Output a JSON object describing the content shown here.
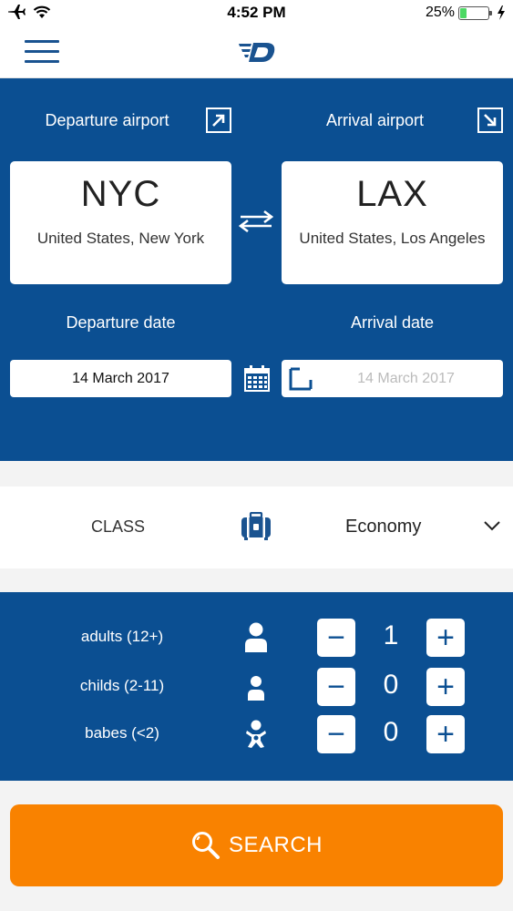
{
  "status_bar": {
    "time": "4:52 PM",
    "battery_percent": "25%",
    "battery_level": 0.25,
    "icons": [
      "airplane-mode-icon",
      "wifi-icon",
      "battery-icon",
      "charging-icon"
    ]
  },
  "nav": {
    "menu_icon": "hamburger-icon",
    "logo_icon": "winged-d-logo"
  },
  "flight": {
    "departure_label": "Departure airport",
    "arrival_label": "Arrival airport",
    "departure": {
      "code": "NYC",
      "city": "United States, New York"
    },
    "arrival": {
      "code": "LAX",
      "city": "United States, Los Angeles"
    },
    "departure_date_label": "Departure date",
    "arrival_date_label": "Arrival date",
    "departure_date": "14 March 2017",
    "arrival_date": "14 March 2017",
    "arrival_date_enabled": false
  },
  "class": {
    "label": "CLASS",
    "value": "Economy"
  },
  "passengers": [
    {
      "label": "adults (12+)",
      "count": "1",
      "icon": "adult-person-icon"
    },
    {
      "label": "childs (2-11)",
      "count": "0",
      "icon": "child-person-icon"
    },
    {
      "label": "babes (<2)",
      "count": "0",
      "icon": "baby-icon"
    }
  ],
  "search": {
    "label": "SEARCH",
    "icon": "search-icon"
  },
  "colors": {
    "primary_blue": "#0b4f92",
    "accent_orange": "#f98200",
    "battery_green": "#4cd964"
  }
}
